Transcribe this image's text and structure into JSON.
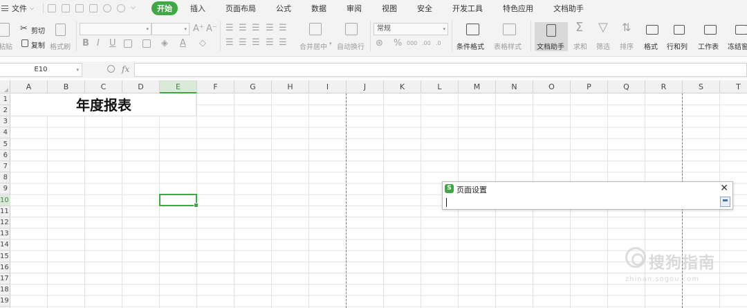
{
  "menubar": {
    "file_label": "文件",
    "tabs": [
      {
        "label": "开始",
        "active": true
      },
      {
        "label": "插入"
      },
      {
        "label": "页面布局"
      },
      {
        "label": "公式"
      },
      {
        "label": "数据"
      },
      {
        "label": "审阅"
      },
      {
        "label": "视图"
      },
      {
        "label": "安全"
      },
      {
        "label": "开发工具"
      },
      {
        "label": "特色应用"
      },
      {
        "label": "文档助手"
      }
    ]
  },
  "ribbon": {
    "paste": "粘贴",
    "cut": "剪切",
    "copy": "复制",
    "format_painter": "格式刷",
    "merge_center": "合并居中",
    "wrap_text": "自动换行",
    "number_format": "常规",
    "conditional_format": "条件格式",
    "table_style": "表格样式",
    "doc_helper": "文档助手",
    "sum": "求和",
    "filter": "筛选",
    "sort": "排序",
    "format": "格式",
    "row_col": "行和列",
    "worksheet": "工作表",
    "freeze": "冻结窗"
  },
  "formula_bar": {
    "name_box": "E10",
    "fx_label": "fx",
    "formula": ""
  },
  "sheet": {
    "columns": [
      "A",
      "B",
      "C",
      "D",
      "E",
      "F",
      "G",
      "H",
      "I",
      "J",
      "K",
      "L",
      "M",
      "N",
      "O",
      "P",
      "Q",
      "R",
      "S",
      "T"
    ],
    "selected_column": "E",
    "rows": [
      "1",
      "2",
      "3",
      "4",
      "5",
      "6",
      "7",
      "8",
      "9",
      "10",
      "11",
      "12",
      "13",
      "14",
      "15",
      "16",
      "17",
      "18",
      "19"
    ],
    "selected_row": "10",
    "title_cell": "年度报表",
    "accent_color": "#3fa743"
  },
  "dialog": {
    "title": "页面设置",
    "logo_letter": "S",
    "close_glyph": "✕",
    "value": ""
  },
  "watermark": {
    "text": "搜狗指南",
    "sub": "zhinan.sogou.com"
  }
}
